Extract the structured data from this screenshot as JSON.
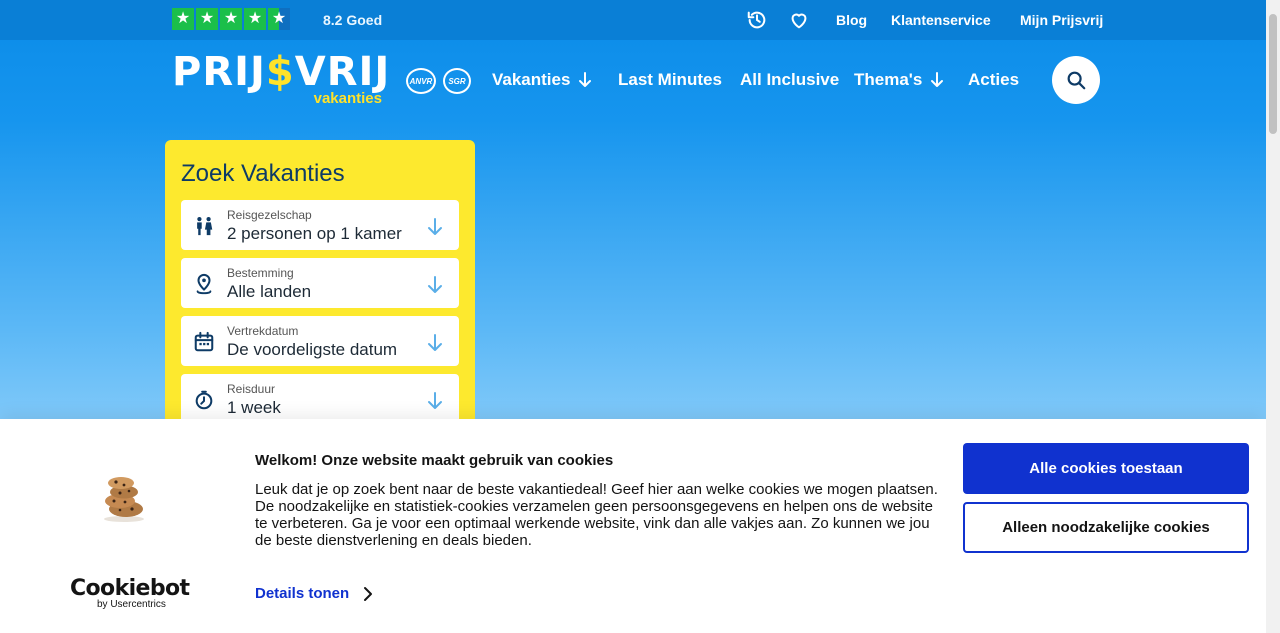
{
  "topbar": {
    "rating_text": "8.2 Goed",
    "stars": [
      "★",
      "★",
      "★",
      "★",
      "★"
    ],
    "links": {
      "blog": "Blog",
      "service": "Klantenservice",
      "account": "Mijn Prijsvrij"
    }
  },
  "logo": {
    "main_pre": "PRIJ",
    "main_dollar": "$",
    "main_post": "VRIJ",
    "sub": "vakanties"
  },
  "badges": {
    "anvr": "ANVR",
    "sgr": "SGR"
  },
  "nav": {
    "vakanties": "Vakanties",
    "last_minutes": "Last Minutes",
    "all_inclusive": "All Inclusive",
    "themas": "Thema's",
    "acties": "Acties"
  },
  "search": {
    "title": "Zoek Vakanties",
    "fields": [
      {
        "label": "Reisgezelschap",
        "value": "2 personen op 1 kamer",
        "icon": "people-icon"
      },
      {
        "label": "Bestemming",
        "value": "Alle landen",
        "icon": "location-pin-icon"
      },
      {
        "label": "Vertrekdatum",
        "value": "De voordeligste datum",
        "icon": "calendar-icon"
      },
      {
        "label": "Reisduur",
        "value": "1 week",
        "icon": "duration-icon"
      }
    ]
  },
  "cookie": {
    "title": "Welkom! Onze website maakt gebruik van cookies",
    "text": "Leuk dat je op zoek bent naar de beste vakantiedeal! Geef hier aan welke cookies we mogen plaatsen. De noodzakelijke en statistiek-cookies verzamelen geen persoonsgegevens en helpen ons de website te verbeteren. Ga je voor een optimaal werkende website, vink dan alle vakjes aan. Zo kunnen we jou de beste dienstverlening en deals bieden.",
    "details": "Details tonen",
    "allow_all": "Alle cookies toestaan",
    "necessary_only": "Alleen noodzakelijke cookies",
    "brand_main": "Cookiebot",
    "brand_sub": "by Usercentrics"
  },
  "colors": {
    "accent_blue": "#1032cf",
    "brand_yellow": "#ffe22a",
    "trust_green": "#1bbf4a"
  }
}
